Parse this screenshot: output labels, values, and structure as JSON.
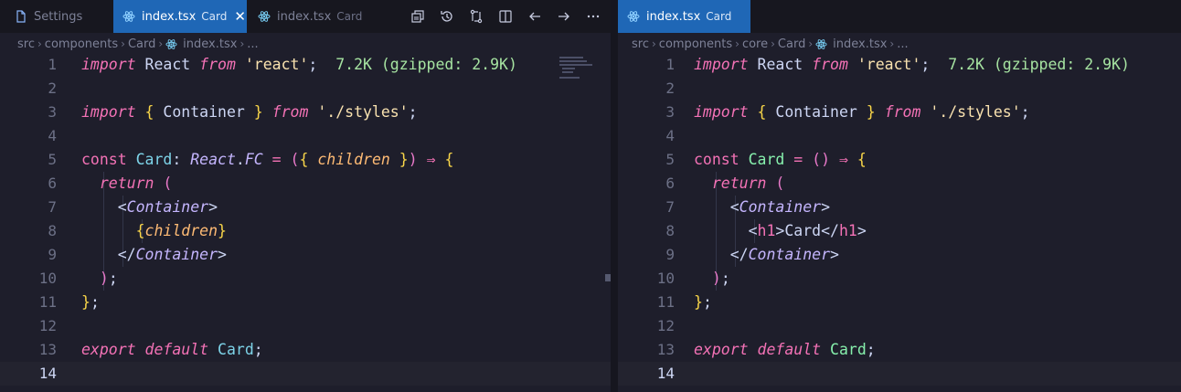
{
  "left_pane": {
    "tabs": [
      {
        "label": "Settings",
        "sub": ""
      },
      {
        "label": "index.tsx",
        "sub": "Card",
        "close": "✕"
      },
      {
        "label": "index.tsx",
        "sub": "Card"
      }
    ],
    "breadcrumb": [
      "src",
      "components",
      "Card",
      "index.tsx",
      "..."
    ],
    "code": [
      {
        "n": "1",
        "tokens": [
          [
            "kw",
            "import"
          ],
          [
            "pl",
            " React "
          ],
          [
            "kw",
            "from"
          ],
          [
            "pl",
            " "
          ],
          [
            "str",
            "'react'"
          ],
          [
            "pl",
            ";  "
          ],
          [
            "hint",
            "7.2K (gzipped: 2.9K)"
          ]
        ]
      },
      {
        "n": "2",
        "tokens": []
      },
      {
        "n": "3",
        "tokens": [
          [
            "kw",
            "import"
          ],
          [
            "pl",
            " "
          ],
          [
            "brc",
            "{"
          ],
          [
            "pl",
            " Container "
          ],
          [
            "brc",
            "}"
          ],
          [
            "pl",
            " "
          ],
          [
            "kw",
            "from"
          ],
          [
            "pl",
            " "
          ],
          [
            "str",
            "'./styles'"
          ],
          [
            "pl",
            ";"
          ]
        ]
      },
      {
        "n": "4",
        "tokens": []
      },
      {
        "n": "5",
        "tokens": [
          [
            "kn",
            "const"
          ],
          [
            "pl",
            " "
          ],
          [
            "var-cyan",
            "Card"
          ],
          [
            "pl",
            ": "
          ],
          [
            "typ",
            "React"
          ],
          [
            "pl",
            "."
          ],
          [
            "typ",
            "FC"
          ],
          [
            "pl",
            " "
          ],
          [
            "op",
            "="
          ],
          [
            "pl",
            " "
          ],
          [
            "paren",
            "("
          ],
          [
            "brc",
            "{"
          ],
          [
            "pl",
            " "
          ],
          [
            "prm",
            "children"
          ],
          [
            "pl",
            " "
          ],
          [
            "brc",
            "}"
          ],
          [
            "paren",
            ")"
          ],
          [
            "pl",
            " "
          ],
          [
            "op",
            "⇒"
          ],
          [
            "pl",
            " "
          ],
          [
            "brc",
            "{"
          ]
        ]
      },
      {
        "n": "6",
        "tokens": [
          [
            "pl",
            "  "
          ],
          [
            "kw",
            "return"
          ],
          [
            "pl",
            " "
          ],
          [
            "paren",
            "("
          ]
        ]
      },
      {
        "n": "7",
        "tokens": [
          [
            "pl",
            "    <"
          ],
          [
            "tag",
            "Container"
          ],
          [
            "pl",
            ">"
          ]
        ]
      },
      {
        "n": "8",
        "tokens": [
          [
            "pl",
            "      "
          ],
          [
            "brc",
            "{"
          ],
          [
            "prm",
            "children"
          ],
          [
            "brc",
            "}"
          ]
        ]
      },
      {
        "n": "9",
        "tokens": [
          [
            "pl",
            "    </"
          ],
          [
            "tag",
            "Container"
          ],
          [
            "pl",
            ">"
          ]
        ]
      },
      {
        "n": "10",
        "tokens": [
          [
            "pl",
            "  "
          ],
          [
            "paren",
            ")"
          ],
          [
            "pl",
            ";"
          ]
        ]
      },
      {
        "n": "11",
        "tokens": [
          [
            "brc",
            "}"
          ],
          [
            "pl",
            ";"
          ]
        ]
      },
      {
        "n": "12",
        "tokens": []
      },
      {
        "n": "13",
        "tokens": [
          [
            "kw",
            "export"
          ],
          [
            "pl",
            " "
          ],
          [
            "kw",
            "default"
          ],
          [
            "pl",
            " "
          ],
          [
            "var-cyan",
            "Card"
          ],
          [
            "pl",
            ";"
          ]
        ]
      },
      {
        "n": "14",
        "tokens": []
      }
    ]
  },
  "right_pane": {
    "tabs": [
      {
        "label": "index.tsx",
        "sub": "Card"
      }
    ],
    "breadcrumb": [
      "src",
      "components",
      "core",
      "Card",
      "index.tsx",
      "..."
    ],
    "code": [
      {
        "n": "1",
        "tokens": [
          [
            "kw",
            "import"
          ],
          [
            "pl",
            " React "
          ],
          [
            "kw",
            "from"
          ],
          [
            "pl",
            " "
          ],
          [
            "str",
            "'react'"
          ],
          [
            "pl",
            ";  "
          ],
          [
            "hint",
            "7.2K (gzipped: 2.9K)"
          ]
        ]
      },
      {
        "n": "2",
        "tokens": []
      },
      {
        "n": "3",
        "tokens": [
          [
            "kw",
            "import"
          ],
          [
            "pl",
            " "
          ],
          [
            "brc",
            "{"
          ],
          [
            "pl",
            " Container "
          ],
          [
            "brc",
            "}"
          ],
          [
            "pl",
            " "
          ],
          [
            "kw",
            "from"
          ],
          [
            "pl",
            " "
          ],
          [
            "str",
            "'./styles'"
          ],
          [
            "pl",
            ";"
          ]
        ]
      },
      {
        "n": "4",
        "tokens": []
      },
      {
        "n": "5",
        "tokens": [
          [
            "kn",
            "const"
          ],
          [
            "pl",
            " "
          ],
          [
            "var-green",
            "Card"
          ],
          [
            "pl",
            " "
          ],
          [
            "op",
            "="
          ],
          [
            "pl",
            " "
          ],
          [
            "paren",
            "()"
          ],
          [
            "pl",
            " "
          ],
          [
            "op",
            "⇒"
          ],
          [
            "pl",
            " "
          ],
          [
            "brc",
            "{"
          ]
        ]
      },
      {
        "n": "6",
        "tokens": [
          [
            "pl",
            "  "
          ],
          [
            "kw",
            "return"
          ],
          [
            "pl",
            " "
          ],
          [
            "paren",
            "("
          ]
        ]
      },
      {
        "n": "7",
        "tokens": [
          [
            "pl",
            "    <"
          ],
          [
            "tag",
            "Container"
          ],
          [
            "pl",
            ">"
          ]
        ]
      },
      {
        "n": "8",
        "tokens": [
          [
            "pl",
            "      <"
          ],
          [
            "h1t",
            "h1"
          ],
          [
            "pl",
            ">Card</"
          ],
          [
            "h1t",
            "h1"
          ],
          [
            "pl",
            ">"
          ]
        ]
      },
      {
        "n": "9",
        "tokens": [
          [
            "pl",
            "    </"
          ],
          [
            "tag",
            "Container"
          ],
          [
            "pl",
            ">"
          ]
        ]
      },
      {
        "n": "10",
        "tokens": [
          [
            "pl",
            "  "
          ],
          [
            "paren",
            ")"
          ],
          [
            "pl",
            ";"
          ]
        ]
      },
      {
        "n": "11",
        "tokens": [
          [
            "brc",
            "}"
          ],
          [
            "pl",
            ";"
          ]
        ]
      },
      {
        "n": "12",
        "tokens": []
      },
      {
        "n": "13",
        "tokens": [
          [
            "kw",
            "export"
          ],
          [
            "pl",
            " "
          ],
          [
            "kw",
            "default"
          ],
          [
            "pl",
            " "
          ],
          [
            "var-green",
            "Card"
          ],
          [
            "pl",
            ";"
          ]
        ]
      },
      {
        "n": "14",
        "tokens": []
      }
    ]
  },
  "current_line": "14",
  "actions": [
    {
      "icon": "open-changes-icon"
    },
    {
      "icon": "timeline-icon"
    },
    {
      "icon": "compare-icon"
    },
    {
      "icon": "split-editor-icon"
    },
    {
      "icon": "go-back-icon"
    },
    {
      "icon": "go-forward-icon"
    },
    {
      "icon": "more-actions-icon"
    }
  ],
  "colors": {
    "active_tab": "#1f67b6",
    "editor_bg": "#1e1e2b",
    "tabbar_bg": "#17171f"
  }
}
